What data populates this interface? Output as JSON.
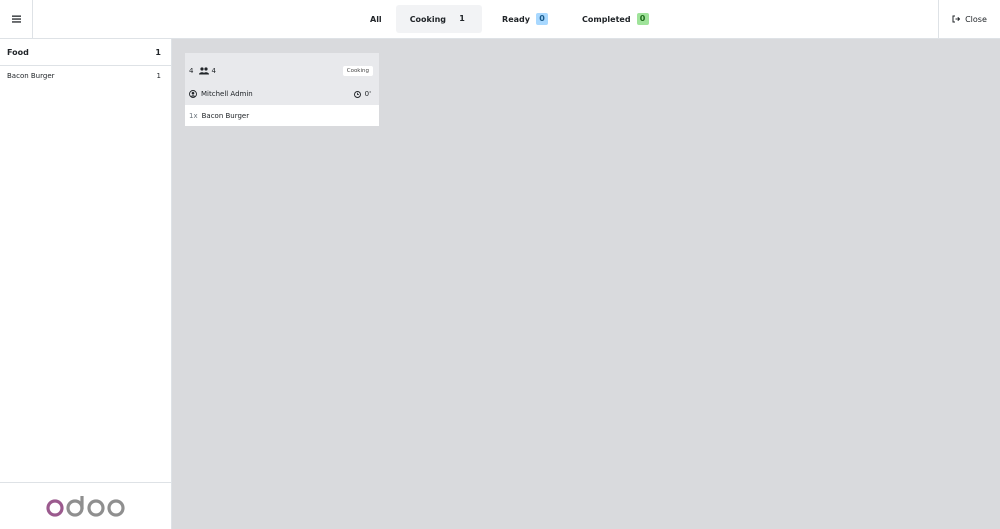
{
  "topbar": {
    "menu_icon": "hamburger-icon",
    "tabs": [
      {
        "label": "All",
        "count": ""
      },
      {
        "label": "Cooking",
        "count": "1"
      },
      {
        "label": "Ready",
        "count": "0"
      },
      {
        "label": "Completed",
        "count": "0"
      }
    ],
    "close_label": "Close",
    "close_icon": "sign-out-icon"
  },
  "sidebar": {
    "category": {
      "label": "Food",
      "count": "1"
    },
    "items": [
      {
        "label": "Bacon Burger",
        "count": "1"
      }
    ],
    "logo": "odoo"
  },
  "order": {
    "table_number": "4",
    "guests": "4",
    "stage": "Cooking",
    "user": "Mitchell Admin",
    "elapsed": "0'",
    "lines": [
      {
        "qty": "1x",
        "product": "Bacon Burger"
      }
    ]
  },
  "colors": {
    "ready_badge": "#a8d8ff",
    "completed_badge": "#9fe39a",
    "background": "#d9dadd",
    "logo": "#9b5a8e"
  }
}
